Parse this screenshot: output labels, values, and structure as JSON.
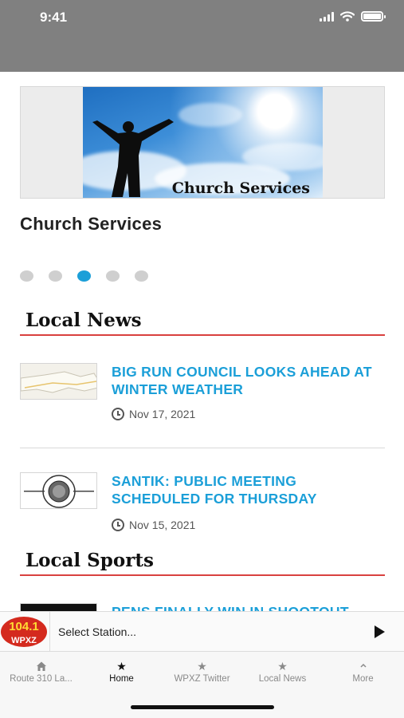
{
  "status_bar": {
    "time": "9:41"
  },
  "carousel": {
    "image_caption": "Church Services",
    "title": "Church Services",
    "slide_count": 5,
    "active_index": 2
  },
  "local_news": {
    "heading": "Local News",
    "articles": [
      {
        "headline": "BIG RUN COUNCIL LOOKS AHEAD AT WINTER WEATHER",
        "date": "Nov 17, 2021"
      },
      {
        "headline": "SANTIK: PUBLIC MEETING SCHEDULED FOR THURSDAY",
        "date": "Nov 15, 2021"
      }
    ]
  },
  "local_sports": {
    "heading": "Local Sports",
    "articles": [
      {
        "headline": "PENS FINALLY WIN IN SHOOTOUT"
      }
    ]
  },
  "player": {
    "logo_text_top": "104.1",
    "logo_text_bottom": "WPXZ",
    "select_label": "Select Station..."
  },
  "tabs": [
    {
      "label": "Route 310 La...",
      "icon": "home-icon"
    },
    {
      "label": "Home",
      "icon": "star-icon",
      "active": true
    },
    {
      "label": "WPXZ Twitter",
      "icon": "star-icon"
    },
    {
      "label": "Local News",
      "icon": "star-icon"
    },
    {
      "label": "More",
      "icon": "chevron-up-icon"
    }
  ],
  "colors": {
    "accent": "#1b9fd8",
    "section_rule": "#d9413f",
    "status_bar": "#808080"
  }
}
